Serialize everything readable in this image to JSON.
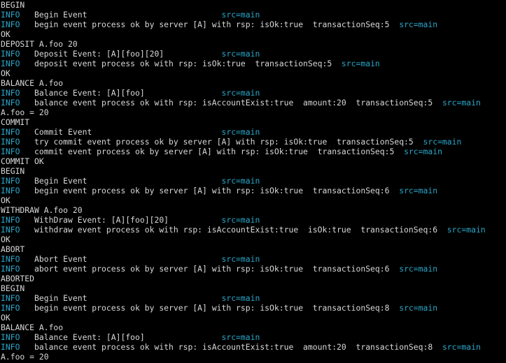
{
  "colors": {
    "background": "#000000",
    "text": "#d8d8d8",
    "info_level": "#2aa7c9",
    "src_tag": "#2aa7c9"
  },
  "lines": [
    {
      "text": "BEGIN"
    },
    {
      "level": "INFO",
      "msg": "Begin Event",
      "src": "src=main"
    },
    {
      "level": "INFO",
      "msg": "begin event process ok by server [A] with rsp: isOk:true  transactionSeq:5",
      "src": "src=main"
    },
    {
      "text": "OK"
    },
    {
      "text": "DEPOSIT A.foo 20"
    },
    {
      "level": "INFO",
      "msg": "Deposit Event: [A][foo][20]",
      "src": "src=main"
    },
    {
      "level": "INFO",
      "msg": "deposit event process ok with rsp: isOk:true  transactionSeq:5",
      "src": "src=main"
    },
    {
      "text": "OK"
    },
    {
      "text": "BALANCE A.foo"
    },
    {
      "level": "INFO",
      "msg": "Balance Event: [A][foo]",
      "src": "src=main"
    },
    {
      "level": "INFO",
      "msg": "balance event process ok with rsp: isAccountExist:true  amount:20  transactionSeq:5",
      "src": "src=main"
    },
    {
      "text": "A.foo = 20"
    },
    {
      "text": "COMMIT"
    },
    {
      "level": "INFO",
      "msg": "Commit Event",
      "src": "src=main"
    },
    {
      "level": "INFO",
      "msg": "try commit event process ok by server [A] with rsp: isOk:true  transactionSeq:5",
      "src": "src=main"
    },
    {
      "level": "INFO",
      "msg": "commit event process ok by server [A] with rsp: isOk:true  transactionSeq:5",
      "src": "src=main"
    },
    {
      "text": "COMMIT OK"
    },
    {
      "text": "BEGIN"
    },
    {
      "level": "INFO",
      "msg": "Begin Event",
      "src": "src=main"
    },
    {
      "level": "INFO",
      "msg": "begin event process ok by server [A] with rsp: isOk:true  transactionSeq:6",
      "src": "src=main"
    },
    {
      "text": "OK"
    },
    {
      "text": "WITHDRAW A.foo 20"
    },
    {
      "level": "INFO",
      "msg": "WithDraw Event: [A][foo][20]",
      "src": "src=main"
    },
    {
      "level": "INFO",
      "msg": "withdraw event process ok with rsp: isAccountExist:true  isOk:true  transactionSeq:6",
      "src": "src=main"
    },
    {
      "text": "OK"
    },
    {
      "text": "ABORT"
    },
    {
      "level": "INFO",
      "msg": "Abort Event",
      "src": "src=main"
    },
    {
      "level": "INFO",
      "msg": "abort event process ok by server [A] with rsp: isOk:true  transactionSeq:6",
      "src": "src=main"
    },
    {
      "text": "ABORTED"
    },
    {
      "text": "BEGIN"
    },
    {
      "level": "INFO",
      "msg": "Begin Event",
      "src": "src=main"
    },
    {
      "level": "INFO",
      "msg": "begin event process ok by server [A] with rsp: isOk:true  transactionSeq:8",
      "src": "src=main"
    },
    {
      "text": "OK"
    },
    {
      "text": "BALANCE A.foo"
    },
    {
      "level": "INFO",
      "msg": "Balance Event: [A][foo]",
      "src": "src=main"
    },
    {
      "level": "INFO",
      "msg": "balance event process ok with rsp: isAccountExist:true  amount:20  transactionSeq:8",
      "src": "src=main"
    },
    {
      "text": "A.foo = 20"
    }
  ]
}
